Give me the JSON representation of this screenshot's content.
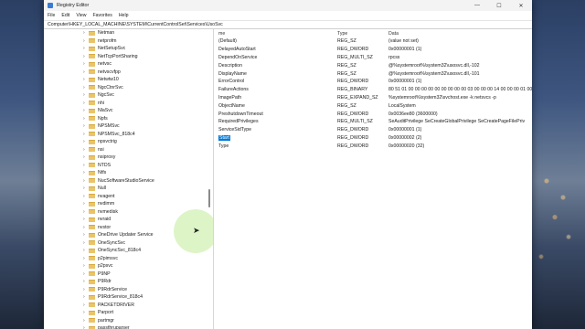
{
  "window": {
    "title": "Registry Editor",
    "minimize": "—",
    "maximize": "☐",
    "close": "✕"
  },
  "menu": [
    "File",
    "Edit",
    "View",
    "Favorites",
    "Help"
  ],
  "address": "Computer\\HKEY_LOCAL_MACHINE\\SYSTEM\\CurrentControlSet\\Services\\UsoSvc",
  "tree": [
    "Netman",
    "netprofm",
    "NetSetupSvc",
    "NetTcpPortSharing",
    "netvsc",
    "netvscvfpp",
    "Netwtw10",
    "NgcCtnrSvc",
    "NgcSvc",
    "nhi",
    "NlaSvc",
    "Npfs",
    "NPSMSvc",
    "NPSMSvc_818c4",
    "npsvctrig",
    "nsi",
    "nsiproxy",
    "NTDS",
    "Ntfs",
    "NucSoftwareStudioService",
    "Null",
    "nvagent",
    "nvdimm",
    "nvmedisk",
    "nvraid",
    "nvstor",
    "OneDrive Updater Service",
    "OneSyncSvc",
    "OneSyncSvc_818c4",
    "p2pimsvc",
    "p2psvc",
    "P9NP",
    "P9Rdr",
    "P9RdrService",
    "P9RdrService_818c4",
    "PACKETDRIVER",
    "Parport",
    "partmgr",
    "passthruparser"
  ],
  "columns": {
    "name": "me",
    "type": "Type",
    "data": "Data"
  },
  "values": [
    {
      "name": "(Default)",
      "type": "REG_SZ",
      "data": "(value not set)"
    },
    {
      "name": "DelayedAutoStart",
      "type": "REG_DWORD",
      "data": "0x00000001 (1)"
    },
    {
      "name": "DependOnService",
      "type": "REG_MULTI_SZ",
      "data": "rpcss"
    },
    {
      "name": "Description",
      "type": "REG_SZ",
      "data": "@%systemroot%\\system32\\usosvc.dll,-102"
    },
    {
      "name": "DisplayName",
      "type": "REG_SZ",
      "data": "@%systemroot%\\system32\\usosvc.dll,-101"
    },
    {
      "name": "ErrorControl",
      "type": "REG_DWORD",
      "data": "0x00000001 (1)"
    },
    {
      "name": "FailureActions",
      "type": "REG_BINARY",
      "data": "80 51 01 00 00 00 00 00 00 00 00 00 03 00 00 00 14 00 00 00 01 00"
    },
    {
      "name": "ImagePath",
      "type": "REG_EXPAND_SZ",
      "data": "%systemroot%\\system32\\svchost.exe -k netsvcs -p"
    },
    {
      "name": "ObjectName",
      "type": "REG_SZ",
      "data": "LocalSystem"
    },
    {
      "name": "PreshutdownTimeout",
      "type": "REG_DWORD",
      "data": "0x0036ee80 (3600000)"
    },
    {
      "name": "RequiredPrivileges",
      "type": "REG_MULTI_SZ",
      "data": "SeAuditPrivilege SeCreateGlobalPrivilege SeCreatePageFilePriv"
    },
    {
      "name": "ServiceSidType",
      "type": "REG_DWORD",
      "data": "0x00000001 (1)"
    },
    {
      "name": "Start",
      "type": "REG_DWORD",
      "data": "0x00000002 (2)",
      "selected": true
    },
    {
      "name": "Type",
      "type": "REG_DWORD",
      "data": "0x00000020 (32)"
    }
  ]
}
